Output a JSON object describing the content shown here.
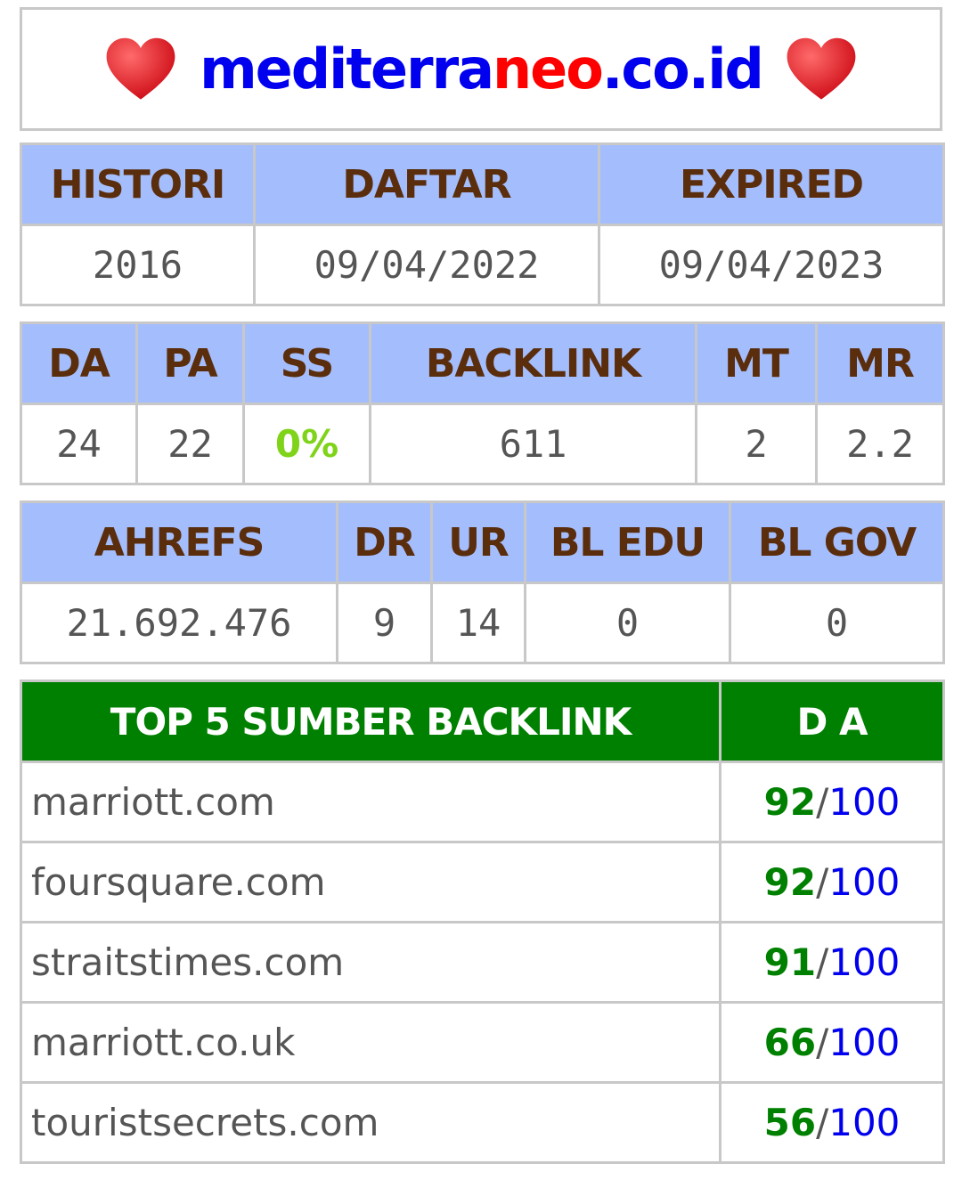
{
  "header": {
    "domain_part1": "mediterra",
    "domain_part2": "neo",
    "domain_part3": ".co.id",
    "left_icon": "heart-icon",
    "right_icon": "heart-icon",
    "heart_color": "#e8222a"
  },
  "registration": {
    "headers": [
      "HISTORI",
      "DAFTAR",
      "EXPIRED"
    ],
    "values": [
      "2016",
      "09/04/2022",
      "09/04/2023"
    ]
  },
  "moz": {
    "headers": [
      "DA",
      "PA",
      "SS",
      "BACKLINK",
      "MT",
      "MR"
    ],
    "values": [
      "24",
      "22",
      "0%",
      "611",
      "2",
      "2.2"
    ]
  },
  "ahrefs": {
    "headers": [
      "AHREFS",
      "DR",
      "UR",
      "BL EDU",
      "BL GOV"
    ],
    "values": [
      "21.692.476",
      "9",
      "14",
      "0",
      "0"
    ]
  },
  "top_backlinks": {
    "headers": [
      "TOP 5 SUMBER BACKLINK",
      "D A"
    ],
    "rows": [
      {
        "site": "marriott.com",
        "da": "92",
        "sep": "/",
        "max": "100"
      },
      {
        "site": "foursquare.com",
        "da": "92",
        "sep": "/",
        "max": "100"
      },
      {
        "site": "straitstimes.com",
        "da": "91",
        "sep": "/",
        "max": "100"
      },
      {
        "site": "marriott.co.uk",
        "da": "66",
        "sep": "/",
        "max": "100"
      },
      {
        "site": "touristsecrets.com",
        "da": "56",
        "sep": "/",
        "max": "100"
      }
    ]
  },
  "colors": {
    "header_bg": "#a4bdfc",
    "header_text": "#5a2d0c",
    "top_header_bg": "#008000",
    "ss_green": "#7fd319",
    "domain_blue": "#0000ee",
    "domain_red": "#ff0000"
  }
}
